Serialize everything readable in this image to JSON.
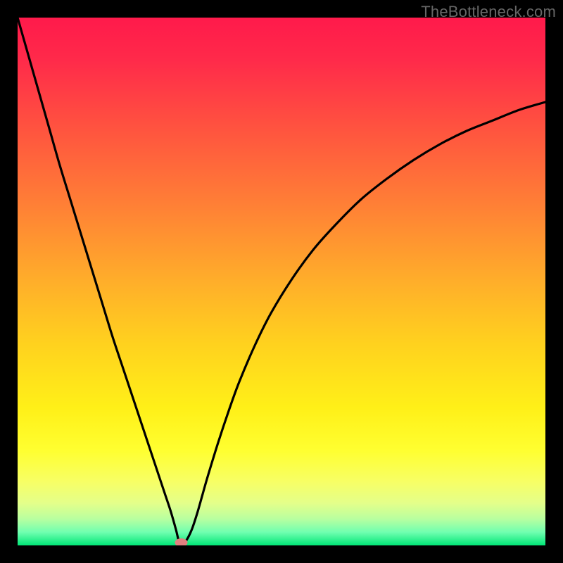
{
  "watermark": "TheBottleneck.com",
  "chart_data": {
    "type": "line",
    "title": "",
    "xlabel": "",
    "ylabel": "",
    "xlim": [
      0,
      100
    ],
    "ylim": [
      0,
      100
    ],
    "grid": false,
    "annotations": [],
    "series": [
      {
        "name": "curve",
        "color": "#000000",
        "x": [
          0,
          2,
          4,
          6,
          8,
          10,
          12,
          14,
          16,
          18,
          20,
          22,
          24,
          26,
          27,
          28,
          29,
          30,
          30.5,
          31,
          32,
          33,
          34,
          35,
          36,
          38,
          40,
          42,
          45,
          48,
          52,
          56,
          60,
          65,
          70,
          75,
          80,
          85,
          90,
          95,
          100
        ],
        "y": [
          100,
          93,
          86,
          79,
          72,
          65.5,
          59,
          52.5,
          46,
          39.5,
          33.5,
          27.5,
          21.5,
          15.5,
          12.5,
          9.5,
          6.5,
          3.0,
          1.0,
          0.0,
          1.0,
          3.0,
          6.0,
          9.5,
          13.0,
          19.5,
          25.5,
          31.0,
          38.0,
          44.0,
          50.5,
          56.0,
          60.5,
          65.5,
          69.5,
          73.0,
          76.0,
          78.5,
          80.5,
          82.5,
          84.0
        ]
      }
    ],
    "marker": {
      "x": 31,
      "y": 0,
      "color": "#e08080"
    },
    "gradient_stops": [
      {
        "offset": 0.0,
        "color": "#ff1a4b"
      },
      {
        "offset": 0.08,
        "color": "#ff2a4a"
      },
      {
        "offset": 0.2,
        "color": "#ff5040"
      },
      {
        "offset": 0.35,
        "color": "#ff7e36"
      },
      {
        "offset": 0.5,
        "color": "#ffae2a"
      },
      {
        "offset": 0.62,
        "color": "#ffd21e"
      },
      {
        "offset": 0.74,
        "color": "#fff018"
      },
      {
        "offset": 0.82,
        "color": "#ffff30"
      },
      {
        "offset": 0.88,
        "color": "#f7ff66"
      },
      {
        "offset": 0.92,
        "color": "#e4ff8a"
      },
      {
        "offset": 0.95,
        "color": "#b8ffa0"
      },
      {
        "offset": 0.975,
        "color": "#70ffb0"
      },
      {
        "offset": 1.0,
        "color": "#00e676"
      }
    ]
  }
}
